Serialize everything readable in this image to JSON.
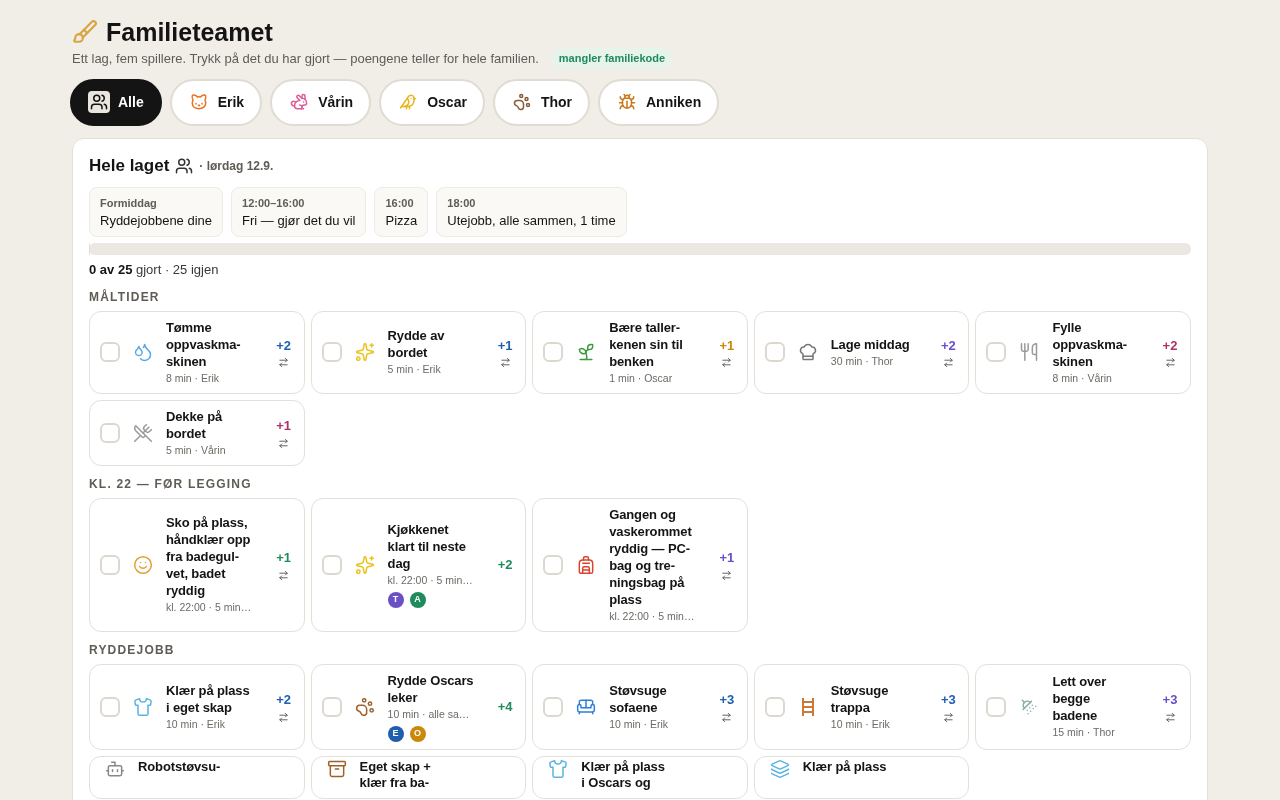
{
  "header": {
    "title": "Familieteamet",
    "subtitle": "Ett lag, fem spillere. Trykk på det du har gjort — poengene teller for hele familien.",
    "badge": "mangler familiekode"
  },
  "tabs": [
    {
      "label": "Alle",
      "selected": true
    },
    {
      "label": "Erik",
      "selected": false
    },
    {
      "label": "Vårin",
      "selected": false
    },
    {
      "label": "Oscar",
      "selected": false
    },
    {
      "label": "Thor",
      "selected": false
    },
    {
      "label": "Anniken",
      "selected": false
    }
  ],
  "panel": {
    "title": "Hele laget",
    "date": "· lørdag 12.9.",
    "schedule": [
      {
        "time": "Formiddag",
        "text": "Ryddejobbene dine"
      },
      {
        "time": "12:00–16:00",
        "text": "Fri — gjør det du vil"
      },
      {
        "time": "16:00",
        "text": "Pizza"
      },
      {
        "time": "18:00",
        "text": "Utejobb, alle sammen, 1 time"
      }
    ],
    "progress": {
      "level": 0,
      "done": "0 av 25",
      "rest": "gjort · 25 igjen"
    },
    "sections": [
      {
        "heading": "MÅLTIDER",
        "tasks": [
          {
            "title_lines": [
              "Tømme",
              "oppvaskma-",
              "skinen"
            ],
            "meta": "8 min · Erik",
            "points": "+2",
            "color": "#1f5fae",
            "checked": false
          },
          {
            "title_lines": [
              "Rydde av",
              "bordet"
            ],
            "meta": "5 min · Erik",
            "points": "+1",
            "color": "#1f5fae",
            "checked": false
          },
          {
            "title_lines": [
              "Bære taller-",
              "kenen sin til",
              "benken"
            ],
            "meta": "1 min · Oscar",
            "points": "+1",
            "color": "#c98a0c",
            "checked": false
          },
          {
            "title_lines": [
              "Lage middag"
            ],
            "meta": "30 min · Thor",
            "points": "+2",
            "color": "#6a4fc6",
            "checked": false
          },
          {
            "title_lines": [
              "Fylle",
              "oppvaskma-",
              "skinen"
            ],
            "meta": "8 min · Vårin",
            "points": "+2",
            "color": "#b0306a",
            "checked": false
          },
          {
            "title_lines": [
              "Dekke på",
              "bordet"
            ],
            "meta": "5 min · Vårin",
            "points": "+1",
            "color": "#b0306a",
            "checked": false
          }
        ]
      },
      {
        "heading": "KL. 22 — FØR LEGGING",
        "tasks": [
          {
            "title_lines": [
              "Sko på plass,",
              "håndklær opp",
              "fra badegul-",
              "vet, badet",
              "ryddig"
            ],
            "meta": "kl. 22:00 · 5 min…",
            "points": "+1",
            "color": "#1f8a5c",
            "checked": false
          },
          {
            "title_lines": [
              "Kjøkkenet",
              "klart til neste",
              "dag"
            ],
            "meta": "kl. 22:00 · 5 min…",
            "points": "+2",
            "color": "#1f8a5c",
            "checked": false,
            "avatars": [
              {
                "letter": "T",
                "color": "#6a4fc6"
              },
              {
                "letter": "A",
                "color": "#1f8a5c"
              }
            ]
          },
          {
            "title_lines": [
              "Gangen og",
              "vaskerommet",
              "ryddig — PC-",
              "bag og tre-",
              "ningsbag på",
              "plass"
            ],
            "meta": "kl. 22:00 · 5 min…",
            "points": "+1",
            "color": "#6a4fc6",
            "checked": false
          }
        ]
      },
      {
        "heading": "RYDDEJOBB",
        "tasks": [
          {
            "title_lines": [
              "Klær på plass",
              "i eget skap"
            ],
            "meta": "10 min · Erik",
            "points": "+2",
            "color": "#1f5fae",
            "checked": false
          },
          {
            "title_lines": [
              "Rydde Oscars",
              "leker"
            ],
            "meta": "10 min · alle sa…",
            "points": "+4",
            "color": "#1f8a5c",
            "checked": false,
            "avatars": [
              {
                "letter": "E",
                "color": "#1f5fae"
              },
              {
                "letter": "O",
                "color": "#c98a0c"
              }
            ]
          },
          {
            "title_lines": [
              "Støvsuge",
              "sofaene"
            ],
            "meta": "10 min · Erik",
            "points": "+3",
            "color": "#1f5fae",
            "checked": false
          },
          {
            "title_lines": [
              "Støvsuge",
              "trappa"
            ],
            "meta": "10 min · Erik",
            "points": "+3",
            "color": "#1f5fae",
            "checked": false
          },
          {
            "title_lines": [
              "Lett over",
              "begge",
              "badene"
            ],
            "meta": "15 min · Thor",
            "points": "+3",
            "color": "#6a4fc6",
            "checked": false
          },
          {
            "title_lines": [
              "Robotstøvsu-"
            ]
          },
          {
            "title_lines": [
              "Eget skap +",
              "klær fra ba-"
            ]
          },
          {
            "title_lines": [
              "Klær på plass",
              "i Oscars og"
            ]
          },
          {
            "title_lines": [
              "Klær på plass"
            ]
          }
        ]
      }
    ]
  }
}
